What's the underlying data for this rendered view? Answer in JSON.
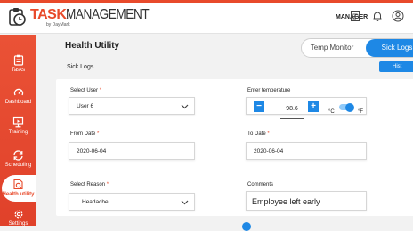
{
  "header": {
    "logo_task": "TASK",
    "logo_management": "MANAGEMENT",
    "logo_sub": "by DayMark",
    "role": "MANAGER"
  },
  "sidebar": {
    "items": [
      {
        "label": "Tasks",
        "icon": "clipboard-icon"
      },
      {
        "label": "Dashboard",
        "icon": "gauge-icon"
      },
      {
        "label": "Training",
        "icon": "training-icon"
      },
      {
        "label": "Scheduling",
        "icon": "sync-icon"
      },
      {
        "label": "Health utility",
        "icon": "health-doc-icon",
        "active": true
      },
      {
        "label": "Settings",
        "icon": "gear-icon"
      }
    ]
  },
  "main": {
    "title": "Health Utility",
    "tabs": [
      {
        "label": "Temp Monitor"
      },
      {
        "label": "Sick Logs",
        "active": true
      }
    ],
    "section": "Sick Logs",
    "history_button": "Hist"
  },
  "form": {
    "select_user_label": "Select User",
    "select_user_value": "User 6",
    "temp_label": "Enter temperature",
    "temp_minus": "−",
    "temp_value": "98.6",
    "temp_plus": "+",
    "unit_c": "°C",
    "unit_f": "°F",
    "from_date_label": "From Date",
    "from_date_value": "2020-06-04",
    "to_date_label": "To Date",
    "to_date_value": "2020-06-04",
    "reason_label": "Select Reason",
    "reason_value": "Headache",
    "comments_label": "Comments",
    "comments_value": "Employee left early",
    "required_mark": "*"
  },
  "colors": {
    "brand_red": "#e84a2b",
    "accent_blue": "#1e88e5"
  }
}
